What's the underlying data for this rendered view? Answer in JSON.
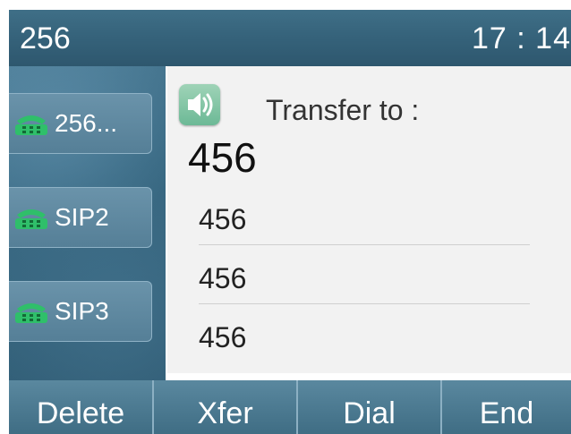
{
  "status_bar": {
    "account": "256",
    "time": "17 : 14"
  },
  "lines": [
    {
      "label": "256...",
      "icon": "phone-icon"
    },
    {
      "label": "SIP2",
      "icon": "phone-icon"
    },
    {
      "label": "SIP3",
      "icon": "phone-icon"
    }
  ],
  "dialog": {
    "icon": "speaker-icon",
    "title": "Transfer to :",
    "input_value": "456",
    "suggestions": [
      "456",
      "456",
      "456"
    ]
  },
  "softkeys": [
    "Delete",
    "Xfer",
    "Dial",
    "End"
  ],
  "colors": {
    "status_bar": "#35627a",
    "softkey_bar": "#4a7990",
    "phone_icon_green": "#2fbf6a",
    "speaker_icon_bg": "#7cc4a0"
  }
}
